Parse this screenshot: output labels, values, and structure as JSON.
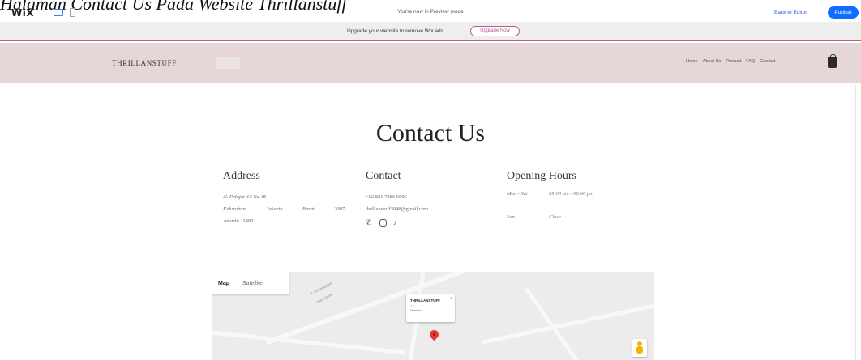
{
  "caption": "Halaman Contact Us Pada Website Thrillanstuff",
  "wix_bar": {
    "logo": "WiX",
    "preview_notice": "You're now in Preview mode",
    "back_to_editor": "Back to Editor",
    "publish": "Publish"
  },
  "upgrade_bar": {
    "text": "Upgrade your website to remove Wix ads",
    "button": "Upgrade Now"
  },
  "site": {
    "brand": "THRILLANSTUFF",
    "nav": [
      "Home",
      "About Us",
      "Product",
      "FAQ",
      "Contact"
    ]
  },
  "page": {
    "title": "Contact Us",
    "address": {
      "heading": "Address",
      "line1": "Jl. Pelajar 12 No.48",
      "line2_parts": [
        "Kelurahan,",
        "Jakarta",
        "Barat",
        "2007"
      ],
      "line3": "Jakarta 11480"
    },
    "contact": {
      "heading": "Contact",
      "phone": "+62 821 7886 6606",
      "email": "thrillanstuff3048@gmail.com"
    },
    "hours": {
      "heading": "Opening Hours",
      "rows": [
        {
          "day": "Mon - Sat",
          "time": "09:00 am - 08:00 pm"
        },
        {
          "day": "Sun",
          "time": "Close"
        }
      ]
    }
  },
  "map": {
    "tab_map": "Map",
    "tab_satellite": "Satellite",
    "card_title": "THRILLANSTUFF",
    "card_sub": "4.6",
    "card_link": "Directions",
    "street_a": "Jl. Kemanggisan",
    "street_b": "Jalan Utama"
  },
  "colors": {
    "header_bg": "#e5d7d7",
    "accent": "#b85c8a",
    "publish": "#116dff"
  }
}
